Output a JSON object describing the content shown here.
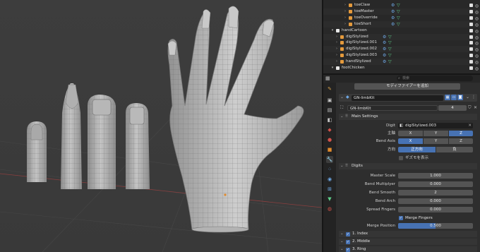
{
  "outliner": {
    "rows": [
      {
        "label": "toeClaw",
        "indent": 4,
        "kind": "bone"
      },
      {
        "label": "toeMaster",
        "indent": 4,
        "kind": "bone"
      },
      {
        "label": "toeOverride",
        "indent": 4,
        "kind": "bone"
      },
      {
        "label": "toeShort",
        "indent": 4,
        "kind": "bone"
      },
      {
        "label": "handCartoon",
        "indent": 1,
        "kind": "collection"
      },
      {
        "label": "digiStylized",
        "indent": 2,
        "kind": "bone"
      },
      {
        "label": "digiStylized.001",
        "indent": 2,
        "kind": "bone"
      },
      {
        "label": "digiStylized.002",
        "indent": 2,
        "kind": "bone"
      },
      {
        "label": "digiStylized.003",
        "indent": 2,
        "kind": "bone"
      },
      {
        "label": "handStylized",
        "indent": 2,
        "kind": "bone"
      },
      {
        "label": "footChicken",
        "indent": 1,
        "kind": "collection"
      }
    ]
  },
  "search": {
    "placeholder": "検索"
  },
  "modifier": {
    "add_label": "モディファイアーを追加",
    "name": "GN-limbKit",
    "node_group": "GN-limbKit",
    "users": "4"
  },
  "main_settings": {
    "title": "Main Settings",
    "digit_label": "Digit",
    "digit_value": "digiStylized.003",
    "main_axis_label": "主軸",
    "bend_axis_label": "Bend Axis",
    "direction_label": "方向",
    "axes": [
      "X",
      "Y",
      "Z"
    ],
    "main_axis_active": "Z",
    "bend_axis_active": "X",
    "directions": [
      "正方向",
      "負"
    ],
    "direction_active": "正方向",
    "show_gizmo": "ギズモを表示"
  },
  "digits": {
    "title": "Digits",
    "fields": [
      {
        "label": "Master Scale",
        "value": "1.000"
      },
      {
        "label": "Bend Multiplyer",
        "value": "0.000"
      },
      {
        "label": "Bend Smooth",
        "value": "2"
      },
      {
        "label": "Bend Arch",
        "value": "0.000"
      },
      {
        "label": "Spread Fingers",
        "value": "0.000"
      }
    ],
    "merge_fingers": "Merge Fingers",
    "merge_position_label": "Merge Position",
    "merge_position_value": "0.500",
    "merge_position_fraction": 0.5,
    "subpanels": [
      "1. Index",
      "2. Middle",
      "3. Ring"
    ]
  },
  "colors": {
    "accent": "#4772b3",
    "panel": "#2e2e2e",
    "viewport": "#3c3c3c",
    "mesh": "#b6b6b6",
    "axis_red": "#8a3f3f"
  }
}
